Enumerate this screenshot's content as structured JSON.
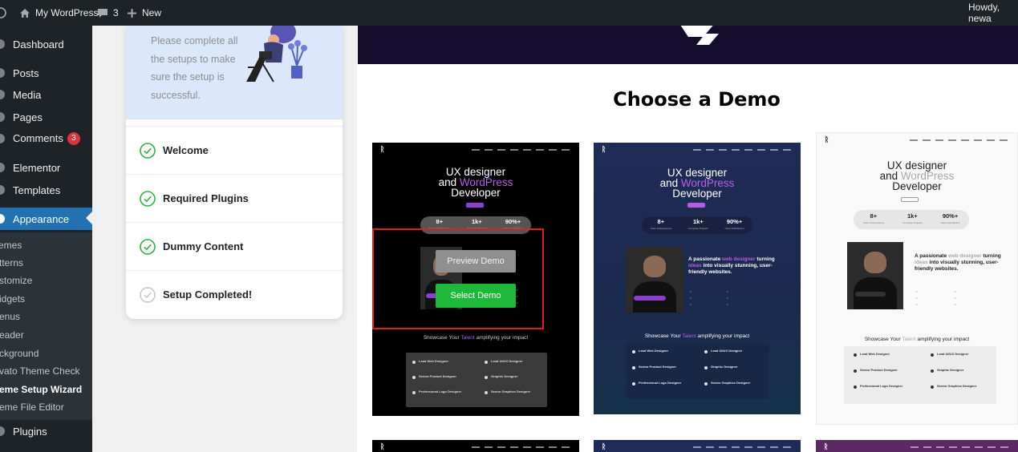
{
  "admin_bar": {
    "site_name": "My WordPress",
    "comment_count": "3",
    "new_label": "New",
    "greeting": "Howdy, newa"
  },
  "sidebar": {
    "items": [
      {
        "label": "Dashboard"
      },
      {
        "label": "Posts"
      },
      {
        "label": "Media"
      },
      {
        "label": "Pages"
      },
      {
        "label": "Comments",
        "badge": "3"
      },
      {
        "label": "Elementor"
      },
      {
        "label": "Templates"
      },
      {
        "label": "Appearance"
      },
      {
        "label": "Plugins"
      }
    ],
    "submenu": [
      "emes",
      "tterns",
      "stomize",
      "idgets",
      "enus",
      "eader",
      "ckground",
      "vato Theme Check",
      "eme Setup Wizard",
      "eme File Editor"
    ]
  },
  "wizard": {
    "intro_text": "Please complete all the setups to make sure the setup is successful.",
    "steps": [
      {
        "label": "Welcome",
        "done": true
      },
      {
        "label": "Required Plugins",
        "done": true
      },
      {
        "label": "Dummy Content",
        "done": true
      },
      {
        "label": "Setup Completed!",
        "done": false
      }
    ]
  },
  "demos": {
    "title": "Choose a Demo",
    "preview_label": "Preview Demo",
    "select_label": "Select Demo",
    "hero_line1": "UX designer",
    "hero_and": "and",
    "hero_wp": "WordPress",
    "hero_line3": "Developer",
    "stats": [
      {
        "value": "8+",
        "label": "Years of Experience"
      },
      {
        "value": "1k+",
        "label": "Complete Projects"
      },
      {
        "value": "90%+",
        "label": "Client Satisfaction"
      }
    ],
    "passion_a": "A passionate",
    "passion_b": "web designer",
    "passion_c": "turning",
    "passion_d": "ideas",
    "passion_e": "into visually",
    "passion_f": "stunning, user-friendly websites.",
    "showcase_a": "Showcase Your",
    "showcase_b": "Talent",
    "showcase_c": "amplifying your impact",
    "jobs": [
      "Lead Web Designer",
      "Senior Product Designer",
      "Professional Logo Designer",
      "Lead UI/UX Designer",
      "Graphic Designer",
      "Senior Graphics Designer"
    ],
    "colors": {
      "dark": "#000000",
      "navy": "#1f2c57",
      "light": "#f9f9f9",
      "accent": "#b65ee8",
      "select_green": "#1eb83b",
      "wp_blue": "#2271b1"
    }
  }
}
